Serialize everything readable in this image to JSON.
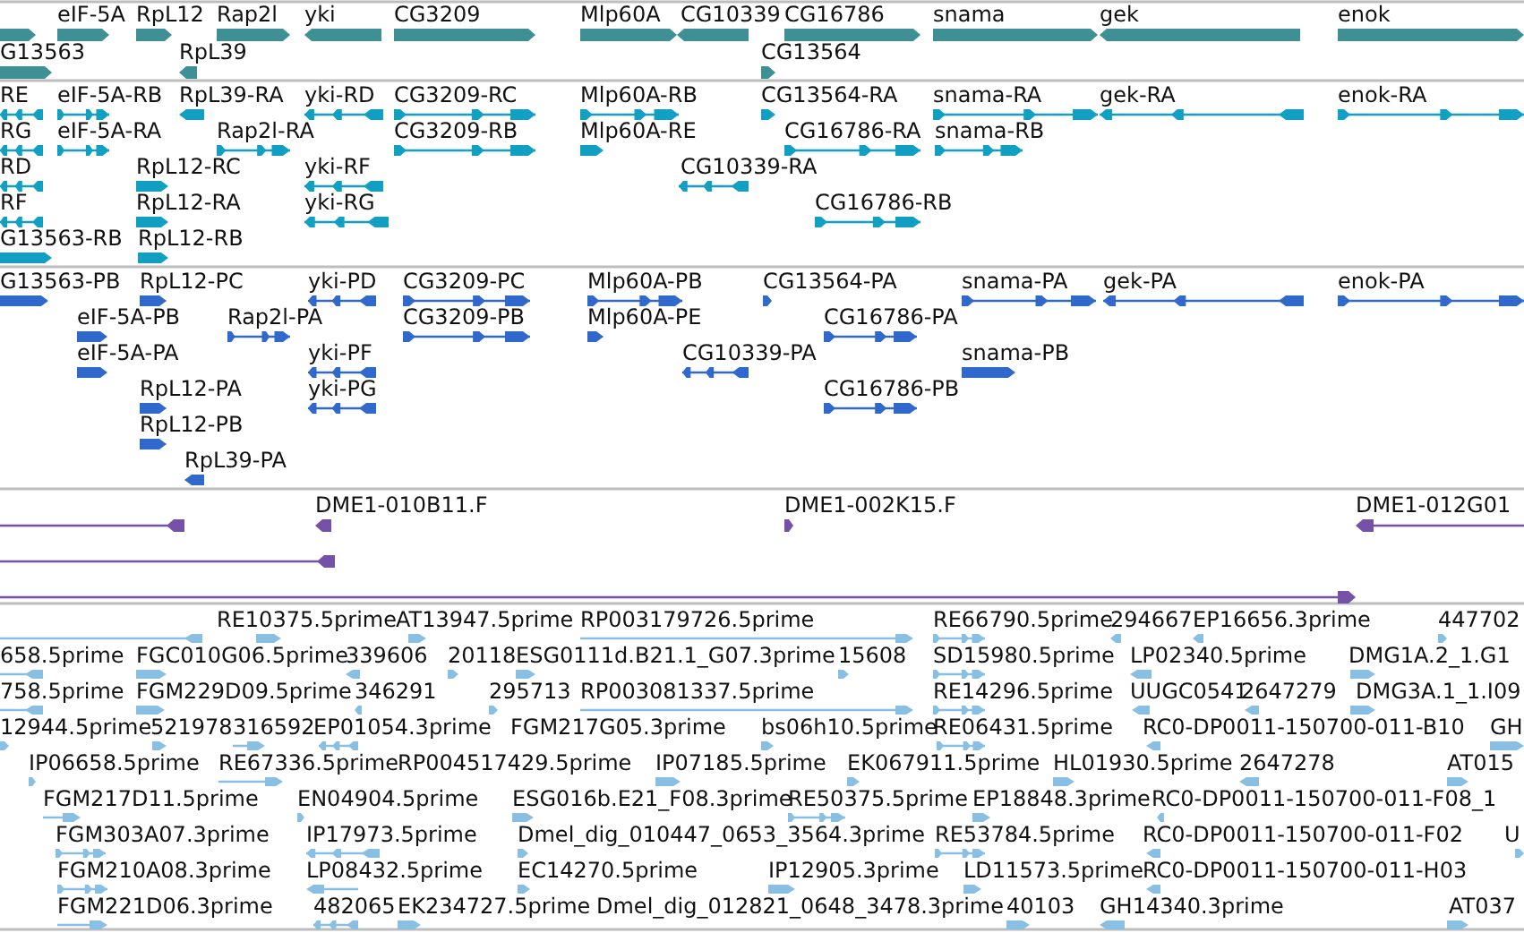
{
  "tracks": [
    {
      "kind": "gene",
      "rows": [
        {
          "features": [
            {
              "reverse": false
            },
            {
              "label": "eIF-5A",
              "reverse": false
            },
            {
              "label": "RpL12",
              "reverse": false
            },
            {
              "label": "Rap2l",
              "reverse": false
            },
            {
              "label": "yki",
              "reverse": true
            },
            {
              "label": "CG3209",
              "reverse": false
            },
            {
              "label": "Mlp60A",
              "reverse": false
            },
            {
              "label": "CG10339",
              "reverse": true
            },
            {
              "label": "CG16786",
              "reverse": false
            },
            {
              "label": "snama",
              "reverse": false
            },
            {
              "label": "gek",
              "reverse": true
            },
            {
              "label": "enok",
              "reverse": false
            }
          ]
        },
        {
          "features": [
            {
              "label": "G13563",
              "reverse": false
            },
            {
              "label": "RpL39",
              "reverse": true
            },
            {
              "label": "CG13564",
              "reverse": false
            }
          ]
        }
      ]
    },
    {
      "kind": "transcript",
      "rows": [
        {
          "features": [
            {
              "label": "RE",
              "reverse": true
            },
            {
              "label": "eIF-5A-RB",
              "reverse": false
            },
            {
              "label": "RpL39-RA",
              "reverse": true
            },
            {
              "label": "yki-RD",
              "reverse": true
            },
            {
              "label": "CG3209-RC",
              "reverse": false
            },
            {
              "label": "Mlp60A-RB",
              "reverse": false
            },
            {
              "label": "CG13564-RA",
              "reverse": false
            },
            {
              "label": "snama-RA",
              "reverse": false
            },
            {
              "label": "gek-RA",
              "reverse": true
            },
            {
              "label": "enok-RA",
              "reverse": false
            }
          ]
        },
        {
          "features": [
            {
              "label": "RG",
              "reverse": true
            },
            {
              "label": "eIF-5A-RA",
              "reverse": false
            },
            {
              "label": "Rap2l-RA",
              "reverse": false
            },
            {
              "label": "CG3209-RB",
              "reverse": false
            },
            {
              "label": "Mlp60A-RE",
              "reverse": false
            },
            {
              "label": "CG16786-RA",
              "reverse": false
            },
            {
              "label": "snama-RB",
              "reverse": false
            }
          ]
        },
        {
          "features": [
            {
              "label": "RD",
              "reverse": true
            },
            {
              "label": "RpL12-RC",
              "reverse": false
            },
            {
              "label": "yki-RF",
              "reverse": true
            },
            {
              "label": "CG10339-RA",
              "reverse": true
            }
          ]
        },
        {
          "features": [
            {
              "label": "RF",
              "reverse": true
            },
            {
              "label": "RpL12-RA",
              "reverse": false
            },
            {
              "label": "yki-RG",
              "reverse": true
            },
            {
              "label": "CG16786-RB",
              "reverse": false
            }
          ]
        },
        {
          "features": [
            {
              "label": "G13563-RB",
              "reverse": false
            },
            {
              "label": "RpL12-RB",
              "reverse": false
            }
          ]
        }
      ]
    },
    {
      "kind": "protein",
      "rows": [
        {
          "features": [
            {
              "label": "G13563-PB",
              "reverse": false
            },
            {
              "label": "RpL12-PC",
              "reverse": false
            },
            {
              "label": "yki-PD",
              "reverse": true
            },
            {
              "label": "CG3209-PC",
              "reverse": false
            },
            {
              "label": "Mlp60A-PB",
              "reverse": false
            },
            {
              "label": "CG13564-PA",
              "reverse": false
            },
            {
              "label": "snama-PA",
              "reverse": false
            },
            {
              "label": "gek-PA",
              "reverse": true
            },
            {
              "label": "enok-PA",
              "reverse": false
            }
          ]
        },
        {
          "features": [
            {
              "label": "eIF-5A-PB",
              "reverse": false
            },
            {
              "label": "Rap2l-PA",
              "reverse": false
            },
            {
              "label": "CG3209-PB",
              "reverse": false
            },
            {
              "label": "Mlp60A-PE",
              "reverse": false
            },
            {
              "label": "CG16786-PA",
              "reverse": false
            }
          ]
        },
        {
          "features": [
            {
              "label": "eIF-5A-PA",
              "reverse": false
            },
            {
              "label": "yki-PF",
              "reverse": true
            },
            {
              "label": "CG10339-PA",
              "reverse": true
            },
            {
              "label": "snama-PB",
              "reverse": false
            }
          ]
        },
        {
          "features": [
            {
              "label": "RpL12-PA",
              "reverse": false
            },
            {
              "label": "yki-PG",
              "reverse": true
            },
            {
              "label": "CG16786-PB",
              "reverse": false
            }
          ]
        },
        {
          "features": [
            {
              "label": "RpL12-PB",
              "reverse": false
            }
          ]
        },
        {
          "features": [
            {
              "label": "RpL39-PA",
              "reverse": true
            }
          ]
        }
      ]
    },
    {
      "kind": "clone",
      "rows": [
        {
          "features": [
            {
              "reverse": true
            },
            {
              "label": "DME1-010B11.F",
              "reverse": true
            },
            {
              "label": "DME1-002K15.F",
              "reverse": false
            },
            {
              "label": "DME1-012G01",
              "reverse": true
            }
          ]
        },
        {
          "features": [
            {
              "reverse": true
            }
          ]
        },
        {
          "features": [
            {
              "reverse": false
            }
          ]
        }
      ]
    },
    {
      "kind": "est",
      "rows": [
        {
          "features": [
            {
              "reverse": true
            },
            {
              "label": "RE10375.5prime",
              "reverse": false
            },
            {
              "label": "AT13947.5prime",
              "reverse": false
            },
            {
              "label": "RP003179726.5prime",
              "reverse": false
            },
            {
              "label": "RE66790.5prime",
              "reverse": false
            },
            {
              "label": "294667",
              "reverse": true
            },
            {
              "label": "EP16656.3prime",
              "reverse": true
            },
            {
              "label": "447702",
              "reverse": false
            }
          ]
        },
        {
          "features": [
            {
              "label": "658.5prime",
              "reverse": true
            },
            {
              "label": "FGC010G06.5prime",
              "reverse": false
            },
            {
              "label": "339606",
              "reverse": true
            },
            {
              "label": "20118",
              "reverse": false
            },
            {
              "label": "ESG0111d.B21.1_G07.3prime",
              "reverse": false
            },
            {
              "label": "15608",
              "reverse": false
            },
            {
              "label": "SD15980.5prime",
              "reverse": false
            },
            {
              "label": "LP02340.5prime",
              "reverse": true
            },
            {
              "label": "DMG1A.2_1.G1",
              "reverse": false
            }
          ]
        },
        {
          "features": [
            {
              "label": "758.5prime",
              "reverse": true
            },
            {
              "label": "FGM229D09.5prime",
              "reverse": false
            },
            {
              "label": "346291",
              "reverse": true
            },
            {
              "label": "295713",
              "reverse": false
            },
            {
              "label": "RP003081337.5prime",
              "reverse": false
            },
            {
              "label": "RE14296.5prime",
              "reverse": false
            },
            {
              "label": "UUGC0541",
              "reverse": true
            },
            {
              "label": "2647279",
              "reverse": true
            },
            {
              "label": "DMG3A.1_1.I09",
              "reverse": false
            }
          ]
        },
        {
          "features": [
            {
              "label": "12944.5prime",
              "reverse": false
            },
            {
              "label": "521978",
              "reverse": false
            },
            {
              "label": "316592",
              "reverse": false
            },
            {
              "label": "EP01054.3prime",
              "reverse": true
            },
            {
              "label": "FGM217G05.3prime"
            },
            {
              "label": "bs06h10.5prime",
              "reverse": false
            },
            {
              "label": "RE06431.5prime",
              "reverse": false
            },
            {
              "label": "RC0-DP0011-150700-011-B10",
              "reverse": true
            },
            {
              "label": "GH",
              "reverse": false
            }
          ]
        },
        {
          "features": [
            {
              "label": "IP06658.5prime",
              "reverse": false
            },
            {
              "label": "RE67336.5prime",
              "reverse": false
            },
            {
              "label": "RP004517429.5prime"
            },
            {
              "label": "IP07185.5prime",
              "reverse": false
            },
            {
              "label": "EK067911.5prime",
              "reverse": false
            },
            {
              "label": "HL01930.5prime",
              "reverse": false
            },
            {
              "label": "2647278",
              "reverse": true
            },
            {
              "label": "AT015",
              "reverse": false
            }
          ]
        },
        {
          "features": [
            {
              "label": "FGM217D11.5prime",
              "reverse": false
            },
            {
              "label": "EN04904.5prime",
              "reverse": false
            },
            {
              "label": "ESG016b.E21_F08.3prime",
              "reverse": false
            },
            {
              "label": "RE50375.5prime",
              "reverse": false
            },
            {
              "label": "EP18848.3prime",
              "reverse": false
            },
            {
              "label": "RC0-DP0011-150700-011-F08_1",
              "reverse": true
            }
          ]
        },
        {
          "features": [
            {
              "label": "FGM303A07.3prime",
              "reverse": false
            },
            {
              "label": "IP17973.5prime",
              "reverse": true
            },
            {
              "label": "Dmel_dig_010447_0653_3564.3prime",
              "reverse": false
            },
            {
              "label": "RE53784.5prime",
              "reverse": false
            },
            {
              "label": "RC0-DP0011-150700-011-F02",
              "reverse": true
            },
            {
              "label": "U",
              "reverse": false
            }
          ]
        },
        {
          "features": [
            {
              "label": "FGM210A08.3prime",
              "reverse": false
            },
            {
              "label": "LP08432.5prime",
              "reverse": true
            },
            {
              "label": "EC14270.5prime",
              "reverse": false
            },
            {
              "label": "IP12905.3prime",
              "reverse": false
            },
            {
              "label": "LD11573.5prime",
              "reverse": false
            },
            {
              "label": "RC0-DP0011-150700-011-H03",
              "reverse": true
            }
          ]
        },
        {
          "features": [
            {
              "label": "FGM221D06.3prime",
              "reverse": false
            },
            {
              "label": "482065",
              "reverse": true
            },
            {
              "label": "EK234727.5prime",
              "reverse": false
            },
            {
              "label": "Dmel_dig_012821_0648_3478.3prime"
            },
            {
              "label": "40103",
              "reverse": false
            },
            {
              "label": "GH14340.3prime",
              "reverse": true
            },
            {
              "label": "AT037",
              "reverse": false
            }
          ]
        }
      ]
    }
  ]
}
